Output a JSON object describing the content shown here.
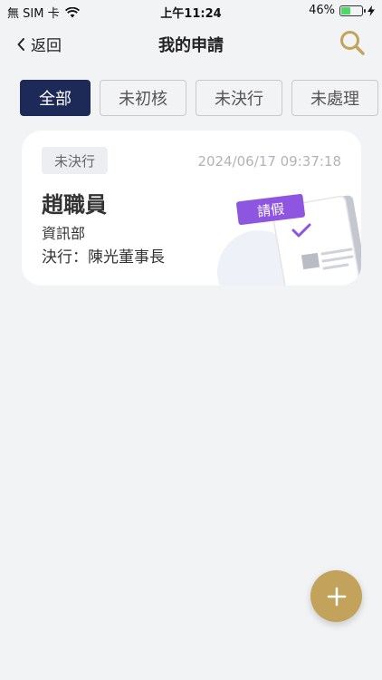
{
  "status_bar": {
    "carrier": "無 SIM 卡",
    "time": "上午11:24",
    "battery": "46%",
    "battery_level": 0.46
  },
  "nav": {
    "back_label": "返回",
    "title": "我的申請"
  },
  "tabs": [
    {
      "label": "全部",
      "active": true
    },
    {
      "label": "未初核",
      "active": false
    },
    {
      "label": "未決行",
      "active": false
    },
    {
      "label": "未處理",
      "active": false
    }
  ],
  "requests": [
    {
      "status": "未決行",
      "timestamp": "2024/06/17 09:37:18",
      "name": "趙職員",
      "department": "資訊部",
      "approver": "決行：陳光董事長",
      "type_tag": "請假"
    }
  ],
  "colors": {
    "accent": "#c3a25c",
    "active_tab": "#1d2a57",
    "tag": "#8d55e0",
    "check": "#8d55e0"
  },
  "icons": {
    "back": "chevron-left-icon",
    "search": "search-icon",
    "add": "plus-icon",
    "wifi": "wifi-icon",
    "battery": "battery-icon",
    "charging": "bolt-icon"
  }
}
